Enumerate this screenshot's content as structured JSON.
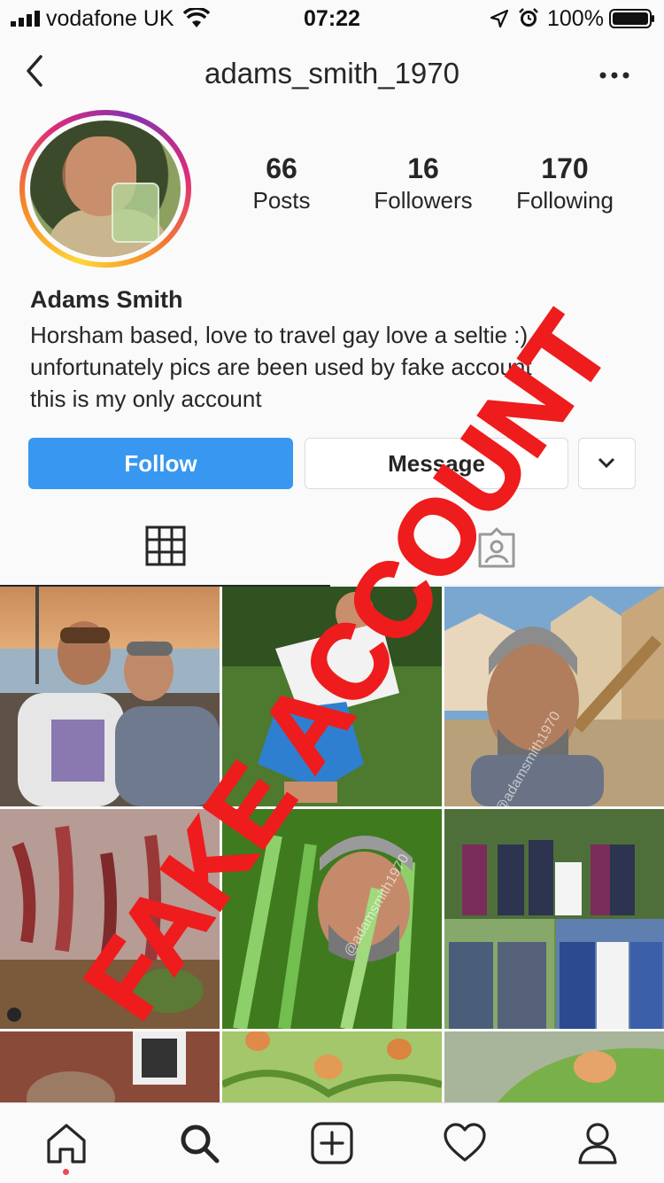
{
  "status_bar": {
    "carrier": "vodafone UK",
    "time": "07:22",
    "battery": "100%",
    "icons": [
      "signal-icon",
      "wifi-icon",
      "location-icon",
      "alarm-icon",
      "battery-icon"
    ]
  },
  "header": {
    "username": "adams_smith_1970",
    "icons": [
      "back-icon",
      "more-options-icon"
    ]
  },
  "profile": {
    "stats": [
      {
        "count": "66",
        "label": "Posts"
      },
      {
        "count": "16",
        "label": "Followers"
      },
      {
        "count": "170",
        "label": "Following"
      }
    ],
    "full_name": "Adams Smith",
    "bio": [
      "Horsham based, love to travel gay love a seltie :)",
      "unfortunately pics are been used by fake account",
      "this is my only account"
    ]
  },
  "actions": {
    "follow_label": "Follow",
    "message_label": "Message",
    "follow_color": "#3897f0",
    "icons": [
      "chevron-down-icon"
    ]
  },
  "tabs": [
    {
      "name": "grid",
      "icon": "grid-icon",
      "selected": true
    },
    {
      "name": "tagged",
      "icon": "tagged-icon",
      "selected": false
    }
  ],
  "photos": [
    {
      "description": "two men selfie at sunset by the sea"
    },
    {
      "description": "man lying on grass"
    },
    {
      "description": "man selfie in front of beach huts",
      "watermark": "@adamsmith1970"
    },
    {
      "description": "carnivorous plants"
    },
    {
      "description": "man among pitcher plants",
      "watermark": "@adamsmith1970"
    },
    {
      "description": "wedding group photos"
    },
    {
      "description": "brick house with window"
    },
    {
      "description": "peach tree"
    },
    {
      "description": "fruit tree leaves"
    }
  ],
  "overlay": {
    "stamp_text": "FAKE ACCOUNT",
    "stamp_color": "#ee1c1c"
  },
  "bottom_nav": [
    {
      "name": "home",
      "icon": "home-icon"
    },
    {
      "name": "search",
      "icon": "search-icon"
    },
    {
      "name": "new-post",
      "icon": "add-post-icon"
    },
    {
      "name": "activity",
      "icon": "heart-icon"
    },
    {
      "name": "profile",
      "icon": "profile-icon"
    }
  ]
}
